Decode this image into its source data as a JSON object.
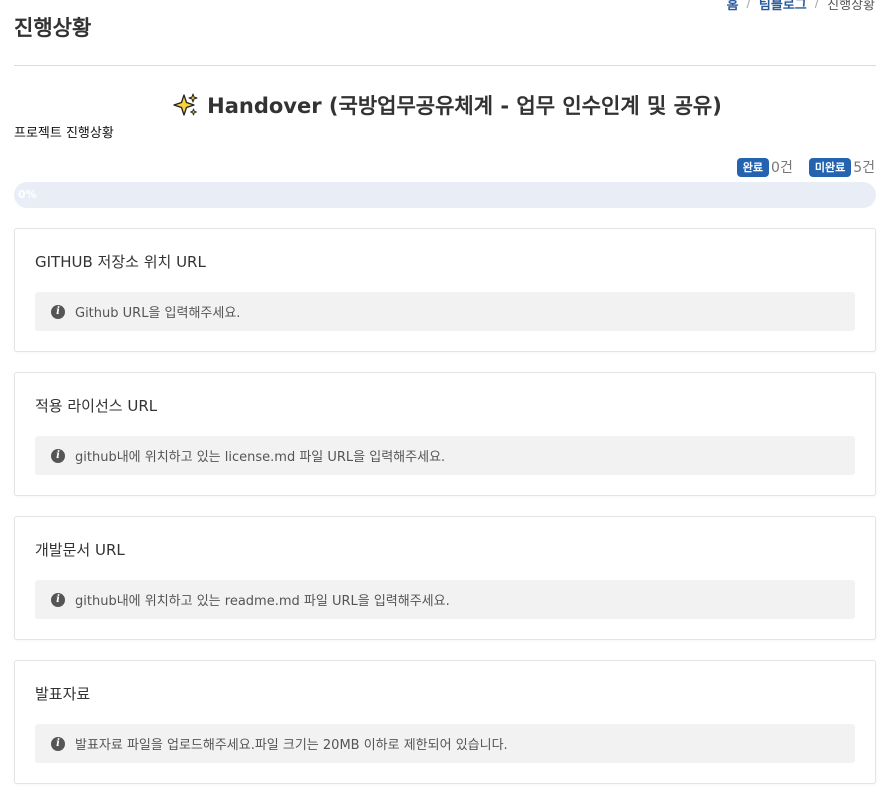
{
  "header": {
    "title": "진행상황",
    "breadcrumb": {
      "home": "홈",
      "blog": "팀블로그",
      "current": "진행상황"
    }
  },
  "project": {
    "title": "Handover (국방업무공유체계 - 업무 인수인계 및 공유)",
    "title_icon": "sparkle-icon",
    "progress_label": "프로젝트 진행상황",
    "complete_label": "완료",
    "complete_count": "0건",
    "incomplete_label": "미완료",
    "incomplete_count": "5건",
    "progress_text": "0%",
    "progress_fraction": 0
  },
  "cards": [
    {
      "title": "GITHUB 저장소 위치 URL",
      "info": "Github URL을 입력해주세요."
    },
    {
      "title": "적용 라이선스 URL",
      "info": "github내에 위치하고 있는 license.md 파일 URL을 입력해주세요."
    },
    {
      "title": "개발문서 URL",
      "info": "github내에 위치하고 있는 readme.md 파일 URL을 입력해주세요."
    },
    {
      "title": "발표자료",
      "info": "발표자료 파일을 업로드해주세요.파일 크기는 20MB 이하로 제한되어 있습니다."
    }
  ],
  "colors": {
    "accent": "#2463b0",
    "track": "#e9edf6"
  }
}
